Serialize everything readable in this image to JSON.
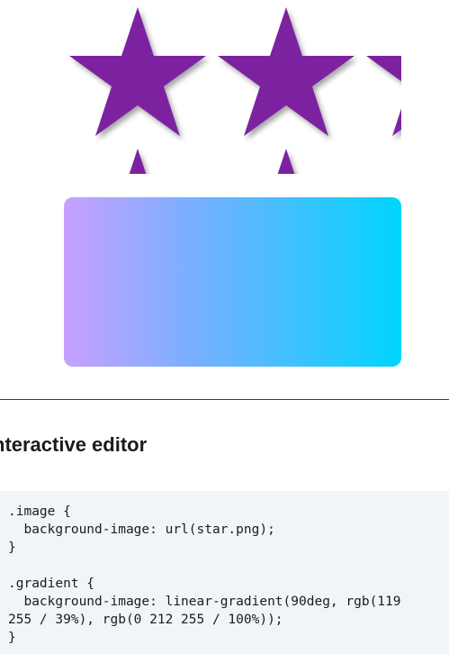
{
  "demo": {
    "star_color": "#7b24a1",
    "gradient_colors": [
      "rgb(119 176 255)",
      "rgb(0 212 255)"
    ]
  },
  "section": {
    "title": "nteractive editor"
  },
  "code": {
    "lines": [
      ".image {",
      "  background-image: url(star.png);",
      "}",
      "",
      ".gradient {",
      "  background-image: linear-gradient(90deg, rgb(119",
      "255 / 39%), rgb(0 212 255 / 100%));",
      "}"
    ]
  }
}
